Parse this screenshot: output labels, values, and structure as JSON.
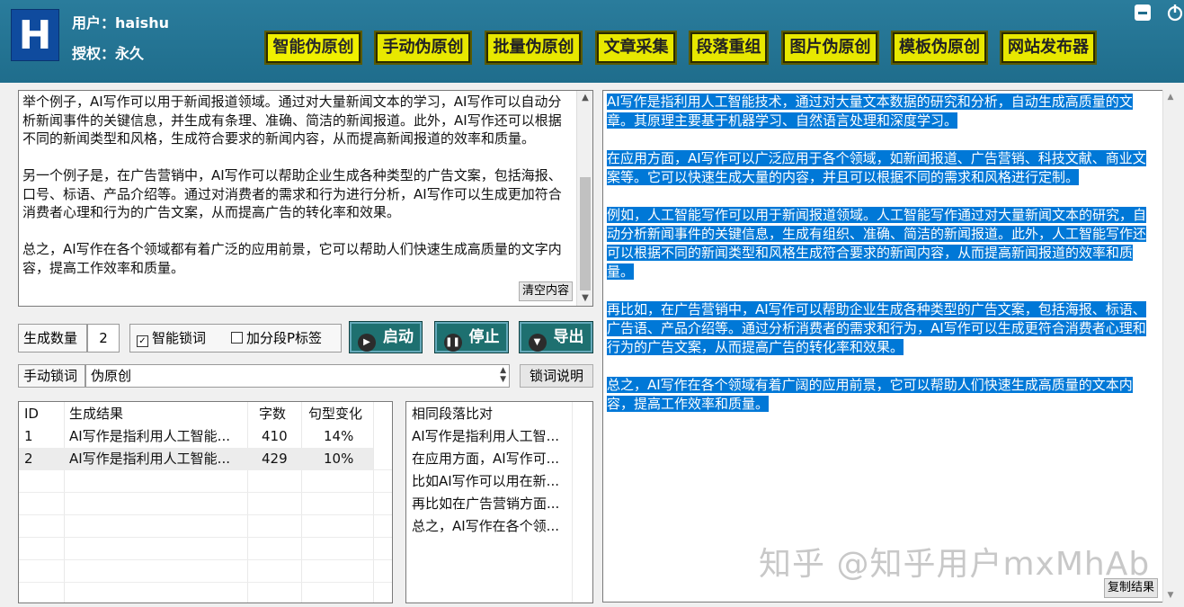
{
  "header": {
    "logo_letter": "H",
    "user_label": "用户：haishu",
    "license_label": "授权：永久",
    "nav": [
      {
        "label": "智能伪原创",
        "active": true
      },
      {
        "label": "手动伪原创",
        "active": false
      },
      {
        "label": "批量伪原创",
        "active": false
      },
      {
        "label": "文章采集",
        "active": false
      },
      {
        "label": "段落重组",
        "active": false
      },
      {
        "label": "图片伪原创",
        "active": false
      },
      {
        "label": "模板伪原创",
        "active": false
      },
      {
        "label": "网站发布器",
        "active": false
      }
    ]
  },
  "source": {
    "text": "举个例子，AI写作可以用于新闻报道领域。通过对大量新闻文本的学习，AI写作可以自动分析新闻事件的关键信息，并生成有条理、准确、简洁的新闻报道。此外，AI写作还可以根据不同的新闻类型和风格，生成符合要求的新闻内容，从而提高新闻报道的效率和质量。\n\n另一个例子是，在广告营销中，AI写作可以帮助企业生成各种类型的广告文案，包括海报、口号、标语、产品介绍等。通过对消费者的需求和行为进行分析，AI写作可以生成更加符合消费者心理和行为的广告文案，从而提高广告的转化率和效果。\n\n总之，AI写作在各个领域都有着广泛的应用前景，它可以帮助人们快速生成高质量的文字内容，提高工作效率和质量。",
    "clear_label": "清空内容"
  },
  "controls": {
    "count_label": "生成数量",
    "count_value": "2",
    "smart_lock_label": "智能锁词",
    "smart_lock_checked": true,
    "p_tag_label": "加分段P标签",
    "p_tag_checked": false,
    "start_label": "启动",
    "stop_label": "停止",
    "export_label": "导出",
    "manual_lock_label": "手动锁词",
    "manual_lock_value": "伪原创",
    "lock_help_label": "锁词说明"
  },
  "results_table": {
    "headers": [
      "ID",
      "生成结果",
      "字数",
      "句型变化"
    ],
    "rows": [
      [
        "1",
        "AI写作是指利用人工智能...",
        "410",
        "14%"
      ],
      [
        "2",
        "AI写作是指利用人工智能...",
        "429",
        "10%"
      ]
    ]
  },
  "compare_table": {
    "header": "相同段落比对",
    "rows": [
      "AI写作是指利用人工智...",
      "在应用方面，AI写作可...",
      "比如AI写作可以用在新...",
      "再比如在广告营销方面...",
      "总之，AI写作在各个领..."
    ]
  },
  "output": {
    "paragraphs": [
      "AI写作是指利用人工智能技术，通过对大量文本数据的研究和分析，自动生成高质量的文章。其原理主要基于机器学习、自然语言处理和深度学习。",
      "在应用方面，AI写作可以广泛应用于各个领域，如新闻报道、广告营销、科技文献、商业文案等。它可以快速生成大量的内容，并且可以根据不同的需求和风格进行定制。",
      "例如，人工智能写作可以用于新闻报道领域。人工智能写作通过对大量新闻文本的研究，自动分析新闻事件的关键信息，生成有组织、准确、简洁的新闻报道。此外，人工智能写作还可以根据不同的新闻类型和风格生成符合要求的新闻内容，从而提高新闻报道的效率和质量。",
      "再比如，在广告营销中，AI写作可以帮助企业生成各种类型的广告文案，包括海报、标语、广告语、产品介绍等。通过分析消费者的需求和行为，AI写作可以生成更符合消费者心理和行为的广告文案，从而提高广告的转化率和效果。",
      "总之，AI写作在各个领域有着广阔的应用前景，它可以帮助人们快速生成高质量的文本内容，提高工作效率和质量。"
    ],
    "copy_label": "复制结果",
    "watermark": "知乎 @知乎用户mxMhAb"
  },
  "colors": {
    "header_bg": "#1f6d8c",
    "nav_button": "#e8e800",
    "action_button": "#1e7070",
    "selection": "#0078d7"
  }
}
